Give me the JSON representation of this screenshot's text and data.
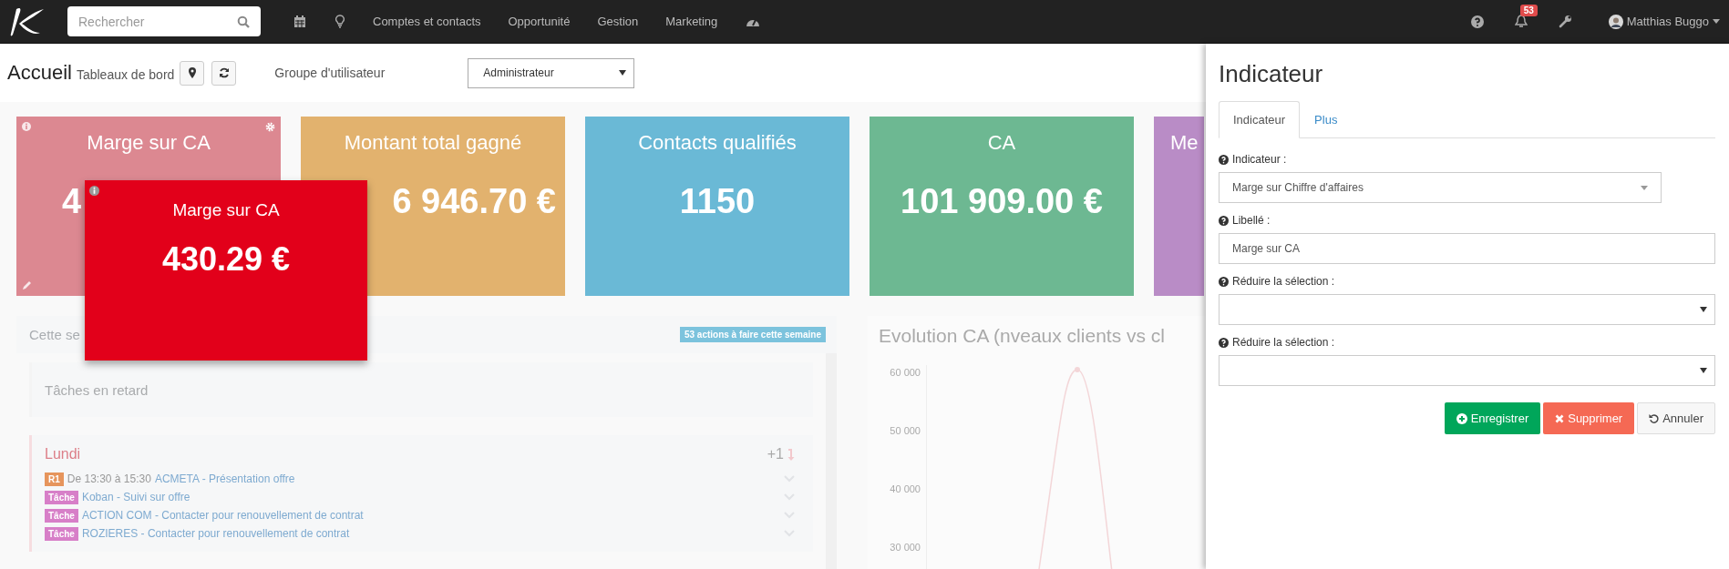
{
  "nav": {
    "search": {
      "placeholder": "Rechercher"
    },
    "menu": [
      "Comptes et contacts",
      "Opportunité",
      "Gestion",
      "Marketing"
    ],
    "notifications": {
      "count": "53"
    },
    "user": {
      "name": "Matthias Buggo"
    }
  },
  "header": {
    "title": "Accueil",
    "subtitle": "Tableaux de bord",
    "group_label": "Groupe d'utilisateur",
    "group_value": "Administrateur"
  },
  "cards": [
    {
      "title": "Marge sur CA",
      "value": "4",
      "color": "#dc8891"
    },
    {
      "title": "Montant total gagné",
      "value": "6 946.70 €",
      "color": "#e2b26e"
    },
    {
      "title": "Contacts qualifiés",
      "value": "1150",
      "color": "#6ab9d6"
    },
    {
      "title": "CA",
      "value": "101 909.00 €",
      "color": "#6db892"
    },
    {
      "title": "Me",
      "color": "#b98cc6"
    }
  ],
  "popup": {
    "title": "Marge sur CA",
    "value": "430.29 €"
  },
  "week": {
    "title": "Cette se",
    "badge": "53 actions à faire cette semaine",
    "overdue": "Tâches en retard",
    "day": {
      "title": "Lundi",
      "count": "+1",
      "items": [
        {
          "tag": "R1",
          "color": "#e6955c",
          "time": "De 13:30 à 15:30",
          "text": "ACMETA - Présentation offre"
        },
        {
          "tag": "Tâche",
          "color": "#d77fc8",
          "text": "Koban - Suivi sur offre"
        },
        {
          "tag": "Tâche",
          "color": "#d77fc8",
          "text": "ACTION COM - Contacter pour renouvellement de contrat"
        },
        {
          "tag": "Tâche",
          "color": "#d77fc8",
          "text": "ROZIERES - Contacter pour renouvellement de contrat"
        }
      ]
    }
  },
  "chart": {
    "title": "Evolution CA (nveaux clients vs cl",
    "y_labels": [
      "60 000",
      "50 000",
      "40 000",
      "30 000"
    ]
  },
  "panel": {
    "title": "Indicateur",
    "tabs": [
      {
        "label": "Indicateur",
        "selected": true
      },
      {
        "label": "Plus",
        "selected": false
      }
    ],
    "fields": [
      {
        "kind": "combo",
        "label": "Indicateur :",
        "value": "Marge sur Chiffre d'affaires"
      },
      {
        "kind": "text",
        "label": "Libellé :",
        "value": "Marge sur CA"
      },
      {
        "kind": "select",
        "label": "Réduire la sélection :"
      },
      {
        "kind": "select",
        "label": "Réduire la sélection :"
      }
    ],
    "buttons": [
      {
        "kind": "save",
        "label": "Enregistrer"
      },
      {
        "kind": "delete",
        "label": "Supprimer"
      },
      {
        "kind": "cancel",
        "label": "Annuler"
      }
    ]
  }
}
